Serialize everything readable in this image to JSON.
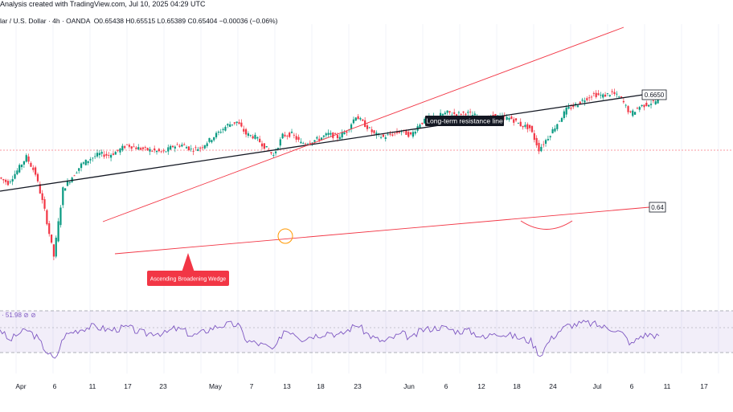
{
  "header": {
    "title_line": "Analysis created with TradingView.com, Jul 10, 2025 04:29 UTC",
    "symbol_line": "lar / U.S. Dollar · 4h · OANDA",
    "ohlc": {
      "open": "O0.65438",
      "high": "H0.65515",
      "low": "L0.65389",
      "close": "C0.65404",
      "change": "−0.00036 (−0.06%)"
    }
  },
  "chart_data": {
    "type": "candlestick",
    "price_range": [
      0.587,
      0.679
    ],
    "series": [
      {
        "name": "price",
        "points": [
          [
            "Apr 1",
            0.6288
          ],
          [
            "Apr 2",
            0.627
          ],
          [
            "Apr 3",
            0.631
          ],
          [
            "Apr 4",
            0.6355
          ],
          [
            "Apr 7",
            0.63
          ],
          [
            "Apr 8",
            0.618
          ],
          [
            "Apr 9",
            0.603
          ],
          [
            "Apr 10",
            0.625
          ],
          [
            "Apr 11",
            0.629
          ],
          [
            "Apr 14",
            0.633
          ],
          [
            "Apr 15",
            0.635
          ],
          [
            "Apr 16",
            0.6365
          ],
          [
            "Apr 17",
            0.636
          ],
          [
            "Apr 18",
            0.6375
          ],
          [
            "Apr 21",
            0.6395
          ],
          [
            "Apr 22",
            0.6385
          ],
          [
            "Apr 23",
            0.638
          ],
          [
            "Apr 24",
            0.6375
          ],
          [
            "Apr 25",
            0.637
          ],
          [
            "Apr 28",
            0.639
          ],
          [
            "Apr 29",
            0.6395
          ],
          [
            "Apr 30",
            0.638
          ],
          [
            "May 1",
            0.6385
          ],
          [
            "May 2",
            0.641
          ],
          [
            "May 5",
            0.6435
          ],
          [
            "May 6",
            0.646
          ],
          [
            "May 7",
            0.647
          ],
          [
            "May 8",
            0.643
          ],
          [
            "May 9",
            0.642
          ],
          [
            "May 12",
            0.639
          ],
          [
            "May 13",
            0.636
          ],
          [
            "May 14",
            0.6425
          ],
          [
            "May 15",
            0.643
          ],
          [
            "May 16",
            0.64
          ],
          [
            "May 19",
            0.6405
          ],
          [
            "May 20",
            0.6415
          ],
          [
            "May 21",
            0.643
          ],
          [
            "May 22",
            0.642
          ],
          [
            "May 23",
            0.644
          ],
          [
            "May 26",
            0.649
          ],
          [
            "May 27",
            0.646
          ],
          [
            "May 28",
            0.643
          ],
          [
            "May 29",
            0.642
          ],
          [
            "May 30",
            0.643
          ],
          [
            "Jun 2",
            0.644
          ],
          [
            "Jun 3",
            0.6425
          ],
          [
            "Jun 4",
            0.6465
          ],
          [
            "Jun 5",
            0.648
          ],
          [
            "Jun 6",
            0.649
          ],
          [
            "Jun 9",
            0.65
          ],
          [
            "Jun 10",
            0.6495
          ],
          [
            "Jun 11",
            0.65
          ],
          [
            "Jun 12",
            0.649
          ],
          [
            "Jun 13",
            0.647
          ],
          [
            "Jun 16",
            0.649
          ],
          [
            "Jun 17",
            0.6485
          ],
          [
            "Jun 18",
            0.648
          ],
          [
            "Jun 19",
            0.646
          ],
          [
            "Jun 20",
            0.645
          ],
          [
            "Jun 23",
            0.638
          ],
          [
            "Jun 24",
            0.642
          ],
          [
            "Jun 25",
            0.6465
          ],
          [
            "Jun 26",
            0.651
          ],
          [
            "Jun 27",
            0.6525
          ],
          [
            "Jun 30",
            0.6545
          ],
          [
            "Jul 1",
            0.656
          ],
          [
            "Jul 2",
            0.6555
          ],
          [
            "Jul 3",
            0.6565
          ],
          [
            "Jul 4",
            0.6545
          ],
          [
            "Jul 7",
            0.6495
          ],
          [
            "Jul 8",
            0.652
          ],
          [
            "Jul 9",
            0.653
          ],
          [
            "Jul 10",
            0.654
          ]
        ]
      }
    ],
    "rsi": {
      "label": "51.98",
      "upper_band": 70,
      "lower_band": 30,
      "values": [
        62,
        45,
        55,
        60,
        50,
        32,
        18,
        52,
        58,
        62,
        65,
        63,
        60,
        62,
        64,
        58,
        55,
        57,
        55,
        62,
        60,
        52,
        56,
        62,
        66,
        68,
        67,
        45,
        42,
        38,
        32,
        60,
        58,
        48,
        52,
        54,
        58,
        52,
        60,
        68,
        56,
        48,
        44,
        50,
        55,
        48,
        60,
        62,
        64,
        62,
        58,
        60,
        55,
        48,
        58,
        54,
        52,
        48,
        45,
        25,
        45,
        58,
        66,
        68,
        70,
        68,
        64,
        62,
        55,
        40,
        52,
        54,
        52
      ]
    },
    "x_ticks": [
      "Apr",
      "6",
      "11",
      "17",
      "23",
      "May",
      "7",
      "13",
      "18",
      "23",
      "Jun",
      "6",
      "12",
      "18",
      "24",
      "Jul",
      "6",
      "11",
      "17"
    ],
    "price_labels": [
      "0.6650",
      "0.64"
    ],
    "annotations": [
      "Long-term resistance line",
      "Ascending Broadening Wedge"
    ]
  }
}
